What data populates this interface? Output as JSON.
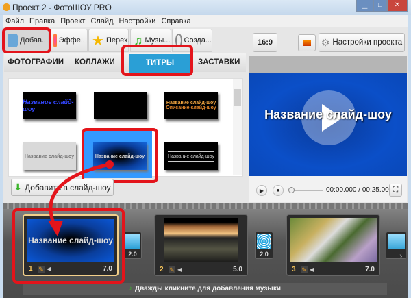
{
  "window": {
    "title": "Проект 2 - ФотоШОУ PRO",
    "min": "▁",
    "max": "□",
    "close": "✕"
  },
  "menu": [
    "Файл",
    "Правка",
    "Проект",
    "Слайд",
    "Настройки",
    "Справка"
  ],
  "tabs": [
    {
      "label": "Добав..."
    },
    {
      "label": "Эффе..."
    },
    {
      "label": "Перех..."
    },
    {
      "label": "Музы..."
    },
    {
      "label": "Созда..."
    }
  ],
  "subtabs": [
    "ФОТОГРАФИИ",
    "КОЛЛАЖИ",
    "ТИТРЫ",
    "ЗАСТАВКИ"
  ],
  "templates": [
    {
      "title": "Название слайд-шоу",
      "sub": ""
    },
    {
      "title": "",
      "sub": ""
    },
    {
      "title": "Название слайд-шоу",
      "sub": "Описание слайд-шоу"
    },
    {
      "title": "Название слайд-шоу",
      "sub": ""
    },
    {
      "title": "Название слайд-шоу",
      "sub": ""
    },
    {
      "title": "Название слайд-шоу",
      "sub": ""
    }
  ],
  "add_button": "Добавить в слайд-шоу",
  "preview": {
    "ratio": "16:9",
    "settings": "Настройки проекта",
    "title": "Название слайд-шоу",
    "time": "00:00.000 / 00:25.000"
  },
  "timeline": {
    "slides": [
      {
        "num": "1",
        "duration": "7.0",
        "title": "Название слайд-шоу"
      },
      {
        "num": "2",
        "duration": "5.0"
      },
      {
        "num": "3",
        "duration": "7.0"
      }
    ],
    "transitions": [
      "2.0",
      "2.0"
    ],
    "music_hint": "Дважды кликните для добавления музыки"
  },
  "colors": {
    "accent": "#2a9fd6",
    "highlight": "#e3141b",
    "selected": "#3399ff"
  }
}
